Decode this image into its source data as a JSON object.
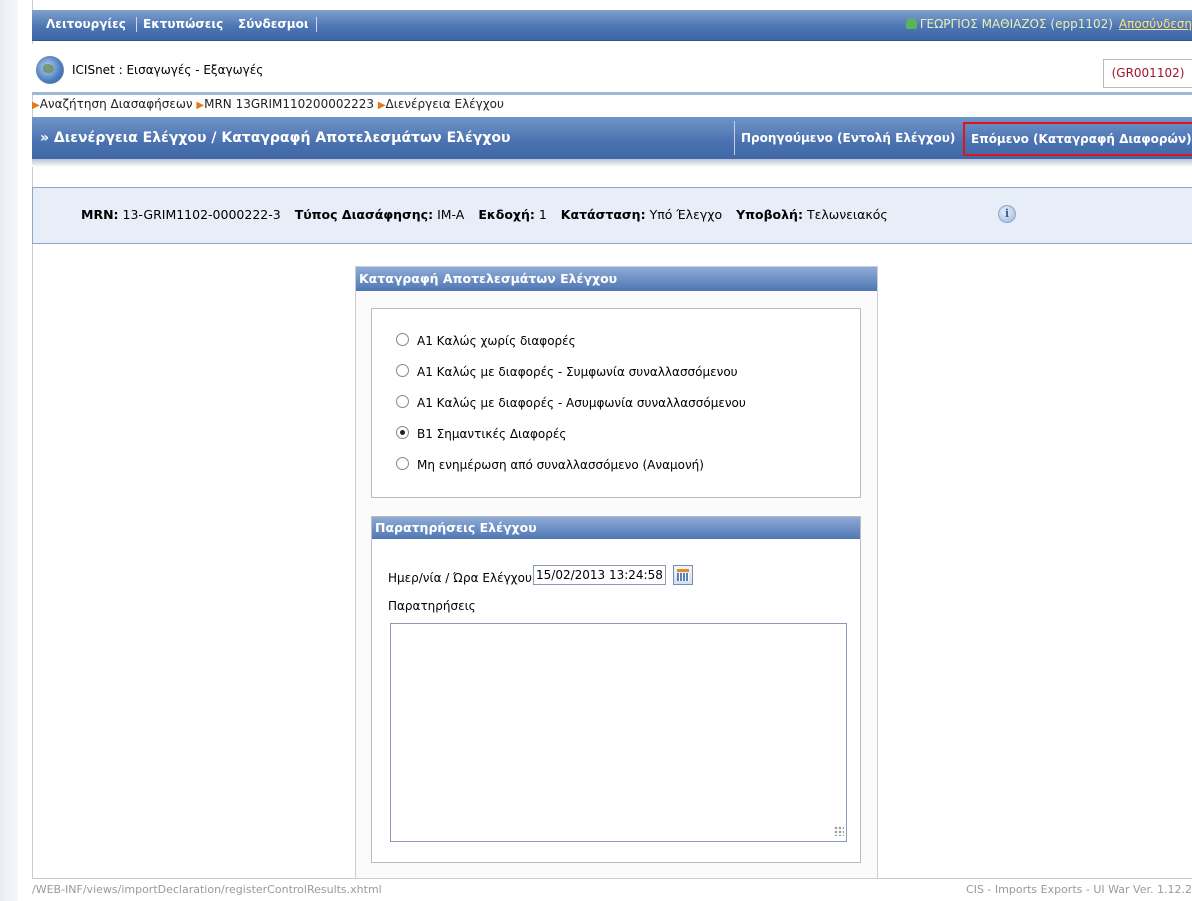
{
  "menu": {
    "items": [
      {
        "label": "Λειτουργίες"
      },
      {
        "label": "Εκτυπώσεις"
      },
      {
        "label": "Σύνδεσμοι"
      }
    ],
    "user": "ΓΕΩΡΓΙΟΣ ΜΑΘΙΑΖΟΣ (epp1102)",
    "logout": "Αποσύνδεση"
  },
  "app": {
    "title": "ICISnet : Εισαγωγές - Εξαγωγές",
    "office_code": "(GR001102)"
  },
  "breadcrumb": [
    {
      "label": "Αναζήτηση Διασαφήσεων"
    },
    {
      "label": "MRN 13GRIM110200002223"
    },
    {
      "label": "Διενέργεια Ελέγχου"
    }
  ],
  "page": {
    "title": "» Διενέργεια Ελέγχου / Καταγραφή Αποτελεσμάτων Ελέγχου",
    "prev_button": "Προηγούμενο (Εντολή Ελέγχου)",
    "next_button": "Επόμενο (Καταγραφή Διαφορών)"
  },
  "info": {
    "mrn_label": "MRN:",
    "mrn_value": "13-GRIM1102-0000222-3",
    "type_label": "Τύπος Διασάφησης:",
    "type_value": "IM-A",
    "version_label": "Εκδοχή:",
    "version_value": "1",
    "status_label": "Κατάσταση:",
    "status_value": "Υπό Έλεγχο",
    "submit_label": "Υποβολή:",
    "submit_value": "Τελωνειακός",
    "info_icon": "i"
  },
  "results": {
    "header": "Καταγραφή Αποτελεσμάτων Ελέγχου",
    "options": [
      {
        "label": "Α1 Καλώς χωρίς διαφορές",
        "checked": false
      },
      {
        "label": "Α1 Καλώς με διαφορές - Συμφωνία συναλλασσόμενου",
        "checked": false
      },
      {
        "label": "Α1 Καλώς με διαφορές - Ασυμφωνία συναλλασσόμενου",
        "checked": false
      },
      {
        "label": "Β1 Σημαντικές Διαφορές",
        "checked": true
      },
      {
        "label": "Μη ενημέρωση από συναλλασσόμενο (Αναμονή)",
        "checked": false
      }
    ]
  },
  "remarks": {
    "header": "Παρατηρήσεις Ελέγχου",
    "date_label": "Ημερ/νία / Ώρα Ελέγχου",
    "date_value": "15/02/2013 13:24:58",
    "remarks_label": "Παρατηρήσεις",
    "remarks_value": ""
  },
  "footer": {
    "path": "/WEB-INF/views/importDeclaration/registerControlResults.xhtml",
    "version": "CIS - Imports Exports - UI War Ver. 1.12.2"
  },
  "colors": {
    "header_blue": "#4e76b3",
    "next_highlight": "#e0141b",
    "office_code": "#a1142b"
  }
}
